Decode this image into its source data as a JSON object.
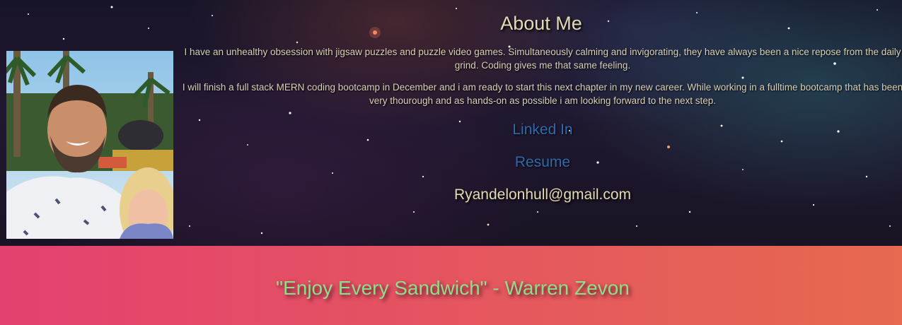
{
  "about": {
    "title": "About Me",
    "paragraphs": [
      "I have an unhealthy obsession with jigsaw puzzles and puzzle video games. Simultaneously calming and invigorating, they have always been a nice repose from the daily grind. Coding gives me that same feeling.",
      "I will finish a full stack MERN coding bootcamp in December and i am ready to start this next chapter in my new career. While working in a fulltime bootcamp that has been very thourough and as hands-on as possible i am looking forward to the next step."
    ],
    "links": {
      "linkedin": "Linked In",
      "resume": "Resume",
      "email": "Ryandelonhull@gmail.com"
    }
  },
  "footer": {
    "quote": "\"Enjoy Every Sandwich\" - Warren Zevon"
  },
  "colors": {
    "title": "#e3d9b2",
    "link": "#2f6aad",
    "quote": "#8fdc8a",
    "footer_start": "#e3416f",
    "footer_end": "#e7694f"
  }
}
